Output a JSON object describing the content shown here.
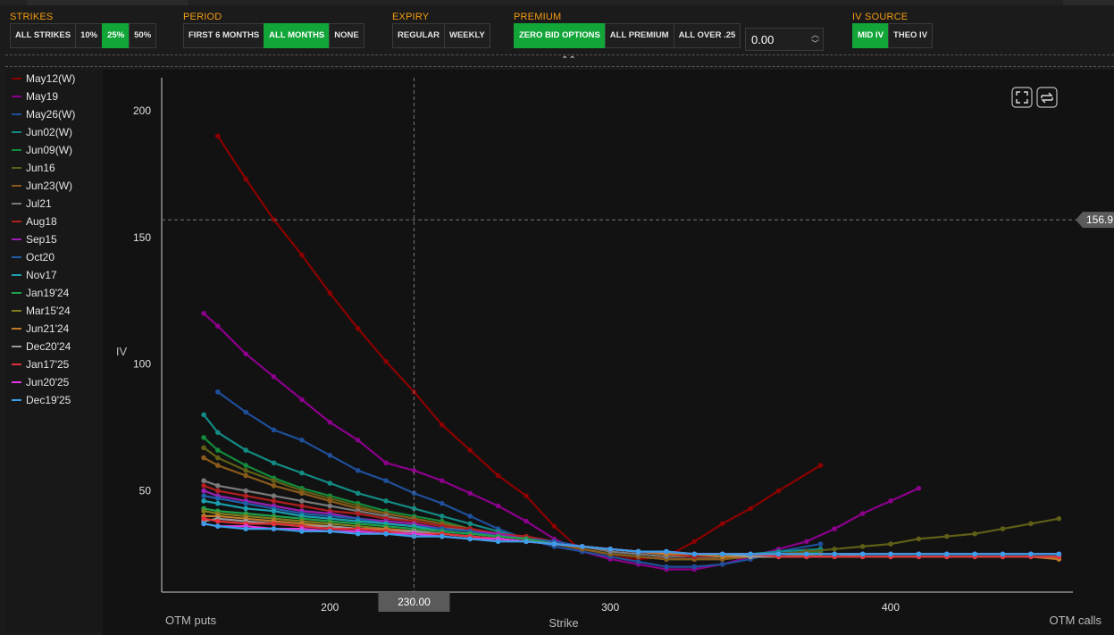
{
  "toolbar": {
    "strikes": {
      "label": "STRIKES",
      "options": [
        "ALL STRIKES",
        "10%",
        "25%",
        "50%"
      ],
      "selected": "25%"
    },
    "period": {
      "label": "PERIOD",
      "options": [
        "FIRST 6 MONTHS",
        "ALL MONTHS",
        "NONE"
      ],
      "selected": "ALL MONTHS"
    },
    "expiry": {
      "label": "EXPIRY",
      "options": [
        "REGULAR",
        "WEEKLY"
      ],
      "selected": ""
    },
    "premium": {
      "label": "PREMIUM",
      "options": [
        "ZERO BID OPTIONS",
        "ALL PREMIUM",
        "ALL OVER .25"
      ],
      "selected": "ZERO BID OPTIONS",
      "value": "0.00"
    },
    "iv_source": {
      "label": "IV SOURCE",
      "options": [
        "MID IV",
        "THEO IV"
      ],
      "selected": "MID IV"
    }
  },
  "chart_data": {
    "type": "line",
    "ylabel": "IV",
    "xlabel": "Strike",
    "x_left_caption": "OTM puts",
    "x_right_caption": "OTM calls",
    "xlim": [
      140,
      465
    ],
    "ylim": [
      10,
      213
    ],
    "xticks": [
      200,
      300,
      400
    ],
    "yticks": [
      50,
      100,
      150,
      200
    ],
    "crosshair": {
      "x": 230,
      "x_label": "230.00",
      "y": 156.9,
      "y_label": "156.9"
    },
    "series": [
      {
        "name": "May12(W)",
        "color": "#8b0000",
        "x": [
          160,
          170,
          180,
          190,
          200,
          210,
          220,
          230,
          240,
          250,
          260,
          270,
          280,
          290,
          300,
          310,
          320,
          330,
          340,
          350,
          360,
          375
        ],
        "y": [
          190,
          173,
          157,
          143,
          128,
          114,
          101,
          89,
          76,
          66,
          56,
          48,
          36,
          26,
          24,
          23,
          24,
          30,
          37,
          43,
          50,
          60
        ]
      },
      {
        "name": "May19",
        "color": "#8b008b",
        "x": [
          155,
          160,
          170,
          180,
          190,
          200,
          210,
          220,
          230,
          240,
          250,
          260,
          270,
          280,
          290,
          300,
          310,
          320,
          330,
          340,
          350,
          360,
          370,
          380,
          390,
          400,
          410
        ],
        "y": [
          120,
          115,
          104,
          95,
          86,
          77,
          70,
          61,
          58,
          54,
          49,
          44,
          38,
          31,
          26,
          23,
          21,
          19,
          19,
          21,
          24,
          27,
          30,
          35,
          41,
          46,
          51
        ]
      },
      {
        "name": "May26(W)",
        "color": "#1f4f9a",
        "x": [
          160,
          170,
          180,
          190,
          200,
          210,
          220,
          230,
          240,
          250,
          260,
          270,
          280,
          290,
          300,
          310,
          320,
          330,
          340,
          350,
          360,
          375
        ],
        "y": [
          89,
          81,
          74,
          70,
          64,
          58,
          54,
          49,
          45,
          40,
          35,
          31,
          28,
          26,
          24,
          22,
          20,
          20,
          21,
          23,
          26,
          29
        ]
      },
      {
        "name": "Jun02(W)",
        "color": "#138b84",
        "x": [
          155,
          160,
          170,
          180,
          190,
          200,
          210,
          220,
          230,
          240,
          250,
          260,
          270,
          280,
          290,
          300,
          310,
          320,
          330,
          340,
          350,
          360,
          375
        ],
        "y": [
          80,
          73,
          66,
          61,
          57,
          53,
          49,
          46,
          43,
          40,
          37,
          34,
          31,
          29,
          27,
          25,
          24,
          23,
          23,
          24,
          25,
          26,
          27
        ]
      },
      {
        "name": "Jun09(W)",
        "color": "#138a3c",
        "x": [
          155,
          160,
          170,
          180,
          190,
          200,
          210,
          220,
          230,
          240,
          250,
          260,
          270,
          280,
          290,
          300,
          310,
          320,
          330,
          340,
          350,
          360,
          375
        ],
        "y": [
          71,
          66,
          60,
          55,
          51,
          48,
          45,
          42,
          40,
          38,
          35,
          33,
          31,
          29,
          27,
          25,
          24,
          23,
          23,
          23,
          24,
          25,
          26
        ]
      },
      {
        "name": "Jun16",
        "color": "#5f5f17",
        "x": [
          155,
          160,
          170,
          180,
          190,
          200,
          210,
          220,
          230,
          240,
          250,
          260,
          270,
          280,
          290,
          300,
          310,
          320,
          330,
          340,
          350,
          360,
          370,
          380,
          390,
          400,
          410,
          420,
          430,
          440,
          450,
          460
        ],
        "y": [
          67,
          63,
          58,
          54,
          50,
          47,
          44,
          41,
          39,
          37,
          35,
          33,
          31,
          29,
          27,
          25,
          24,
          23,
          23,
          23,
          24,
          25,
          26,
          27,
          28,
          29,
          31,
          32,
          33,
          35,
          37,
          39
        ]
      },
      {
        "name": "Jun23(W)",
        "color": "#8b5a1a",
        "x": [
          155,
          160,
          170,
          180,
          190,
          200,
          210,
          220,
          230,
          240,
          250,
          260,
          270,
          280,
          290,
          300,
          310,
          320,
          330,
          340,
          350,
          360,
          375
        ],
        "y": [
          63,
          60,
          56,
          52,
          49,
          46,
          43,
          41,
          39,
          37,
          35,
          33,
          31,
          29,
          27,
          25,
          24,
          23,
          23,
          23,
          24,
          24,
          25
        ]
      },
      {
        "name": "Jul21",
        "color": "#7a7a7a",
        "x": [
          155,
          160,
          170,
          180,
          190,
          200,
          210,
          220,
          230,
          240,
          250,
          260,
          270,
          280,
          290,
          300,
          310,
          320,
          330,
          340,
          350,
          360,
          370,
          380,
          390,
          400,
          410,
          420,
          430,
          440,
          450,
          460
        ],
        "y": [
          54,
          52,
          50,
          48,
          46,
          44,
          42,
          40,
          38,
          36,
          34,
          33,
          31,
          29,
          28,
          26,
          25,
          24,
          24,
          24,
          24,
          24,
          24,
          24,
          25,
          25,
          25,
          25,
          25,
          25,
          25,
          25
        ]
      },
      {
        "name": "Aug18",
        "color": "#b01e1e",
        "x": [
          155,
          160,
          170,
          180,
          190,
          200,
          210,
          220,
          230,
          240,
          250,
          260,
          270,
          280,
          290,
          300,
          310,
          320,
          330,
          340,
          350,
          360,
          370,
          380,
          390,
          400,
          410,
          420,
          430,
          440,
          450,
          460
        ],
        "y": [
          52,
          50,
          48,
          46,
          44,
          42,
          41,
          39,
          38,
          36,
          35,
          33,
          32,
          30,
          28,
          27,
          26,
          25,
          24,
          24,
          24,
          24,
          24,
          24,
          24,
          24,
          24,
          24,
          24,
          24,
          24,
          24
        ]
      },
      {
        "name": "Sep15",
        "color": "#9b1fb0",
        "x": [
          155,
          160,
          170,
          180,
          190,
          200,
          210,
          220,
          230,
          240,
          250,
          260,
          270,
          280,
          290,
          300,
          310,
          320,
          330,
          340,
          350,
          360,
          370,
          380,
          390,
          400,
          410,
          420,
          430,
          440,
          450,
          460
        ],
        "y": [
          50,
          48,
          46,
          44,
          42,
          41,
          39,
          38,
          37,
          35,
          34,
          33,
          31,
          30,
          28,
          27,
          26,
          25,
          25,
          25,
          25,
          25,
          25,
          25,
          25,
          25,
          25,
          25,
          25,
          25,
          25,
          25
        ]
      },
      {
        "name": "Oct20",
        "color": "#1f5fa8",
        "x": [
          155,
          160,
          170,
          180,
          190,
          200,
          210,
          220,
          230,
          240,
          250,
          260,
          270,
          280,
          290,
          300,
          310,
          320,
          330,
          340,
          350,
          360,
          370,
          380,
          390,
          400,
          410,
          420,
          430,
          440,
          450,
          460
        ],
        "y": [
          48,
          47,
          45,
          43,
          41,
          40,
          39,
          37,
          36,
          35,
          34,
          32,
          31,
          30,
          28,
          27,
          26,
          25,
          25,
          25,
          25,
          25,
          25,
          25,
          25,
          25,
          25,
          25,
          25,
          25,
          25,
          25
        ]
      },
      {
        "name": "Nov17",
        "color": "#1ba0b0",
        "x": [
          155,
          160,
          170,
          180,
          190,
          200,
          210,
          220,
          230,
          240,
          250,
          260,
          270,
          280,
          290,
          300,
          310,
          320,
          330,
          340,
          350,
          360,
          370,
          380,
          390,
          400,
          410,
          420,
          430,
          440,
          450,
          460
        ],
        "y": [
          46,
          45,
          43,
          42,
          40,
          39,
          38,
          37,
          36,
          34,
          33,
          32,
          31,
          29,
          28,
          27,
          26,
          25,
          25,
          25,
          25,
          25,
          25,
          25,
          25,
          25,
          25,
          25,
          25,
          25,
          25,
          25
        ]
      },
      {
        "name": "Jan19'24",
        "color": "#1fa04a",
        "x": [
          155,
          160,
          170,
          180,
          190,
          200,
          210,
          220,
          230,
          240,
          250,
          260,
          270,
          280,
          290,
          300,
          310,
          320,
          330,
          340,
          350,
          360,
          370,
          380,
          390,
          400,
          410,
          420,
          430,
          440,
          450,
          460
        ],
        "y": [
          43,
          42,
          41,
          40,
          39,
          38,
          37,
          36,
          35,
          34,
          33,
          32,
          31,
          29,
          28,
          27,
          26,
          25,
          25,
          24,
          24,
          24,
          24,
          24,
          24,
          24,
          24,
          24,
          24,
          24,
          24,
          24
        ]
      },
      {
        "name": "Mar15'24",
        "color": "#7d7d1f",
        "x": [
          155,
          160,
          170,
          180,
          190,
          200,
          210,
          220,
          230,
          240,
          250,
          260,
          270,
          280,
          290,
          300,
          310,
          320,
          330,
          340,
          350,
          360,
          370,
          380,
          390,
          400,
          410,
          420,
          430,
          440,
          450,
          460
        ],
        "y": [
          42,
          41,
          40,
          39,
          38,
          37,
          36,
          35,
          34,
          33,
          32,
          31,
          30,
          29,
          28,
          27,
          26,
          25,
          25,
          24,
          24,
          24,
          24,
          24,
          24,
          24,
          24,
          24,
          24,
          24,
          24,
          24
        ]
      },
      {
        "name": "Jun21'24",
        "color": "#c07a2a",
        "x": [
          155,
          160,
          170,
          180,
          190,
          200,
          210,
          220,
          230,
          240,
          250,
          260,
          270,
          280,
          290,
          300,
          310,
          320,
          330,
          340,
          350,
          360,
          370,
          380,
          390,
          400,
          410,
          420,
          430,
          440,
          450,
          460
        ],
        "y": [
          40,
          40,
          39,
          38,
          37,
          36,
          35,
          35,
          34,
          33,
          32,
          31,
          30,
          29,
          28,
          27,
          26,
          25,
          25,
          24,
          24,
          24,
          24,
          24,
          24,
          24,
          24,
          24,
          24,
          24,
          24,
          23
        ]
      },
      {
        "name": "Dec20'24",
        "color": "#9a9a9a",
        "x": [
          155,
          160,
          170,
          180,
          190,
          200,
          210,
          220,
          230,
          240,
          250,
          260,
          270,
          280,
          290,
          300,
          310,
          320,
          330,
          340,
          350,
          360,
          370,
          380,
          390,
          400,
          410,
          420,
          430,
          440,
          450,
          460
        ],
        "y": [
          38,
          39,
          38,
          37,
          36,
          36,
          35,
          34,
          34,
          33,
          32,
          31,
          30,
          29,
          28,
          27,
          26,
          26,
          25,
          25,
          24,
          24,
          24,
          24,
          24,
          24,
          24,
          24,
          24,
          24,
          24,
          24
        ]
      },
      {
        "name": "Jan17'25",
        "color": "#e0303a",
        "x": [
          155,
          160,
          170,
          180,
          190,
          200,
          210,
          220,
          230,
          240,
          250,
          260,
          270,
          280,
          290,
          300,
          310,
          320,
          330,
          340,
          350,
          360,
          370,
          380,
          390,
          400,
          410,
          420,
          430,
          440,
          450,
          460
        ],
        "y": [
          39,
          38,
          37,
          37,
          36,
          35,
          35,
          34,
          33,
          33,
          32,
          31,
          30,
          29,
          28,
          27,
          26,
          26,
          25,
          25,
          25,
          24,
          24,
          24,
          24,
          24,
          24,
          24,
          24,
          24,
          24,
          24
        ]
      },
      {
        "name": "Jun20'25",
        "color": "#e03ae0",
        "x": [
          155,
          160,
          170,
          180,
          190,
          200,
          210,
          220,
          230,
          240,
          250,
          260,
          270,
          280,
          290,
          300,
          310,
          320,
          330,
          340,
          350,
          360,
          370,
          380,
          390,
          400,
          410,
          420,
          430,
          440,
          450,
          460
        ],
        "y": [
          37,
          36,
          36,
          35,
          35,
          34,
          34,
          33,
          33,
          32,
          31,
          31,
          30,
          29,
          28,
          27,
          26,
          26,
          25,
          25,
          25,
          25,
          25,
          25,
          25,
          25,
          25,
          25,
          25,
          25,
          25,
          25
        ]
      },
      {
        "name": "Dec19'25",
        "color": "#3a9ee8",
        "x": [
          155,
          160,
          170,
          180,
          190,
          200,
          210,
          220,
          230,
          240,
          250,
          260,
          270,
          280,
          290,
          300,
          310,
          320,
          330,
          340,
          350,
          360,
          370,
          380,
          390,
          400,
          410,
          420,
          430,
          440,
          450,
          460
        ],
        "y": [
          37,
          36,
          35,
          35,
          34,
          34,
          33,
          33,
          32,
          32,
          31,
          30,
          30,
          29,
          28,
          27,
          26,
          26,
          25,
          25,
          25,
          25,
          25,
          25,
          25,
          25,
          25,
          25,
          25,
          25,
          25,
          25
        ]
      }
    ]
  }
}
